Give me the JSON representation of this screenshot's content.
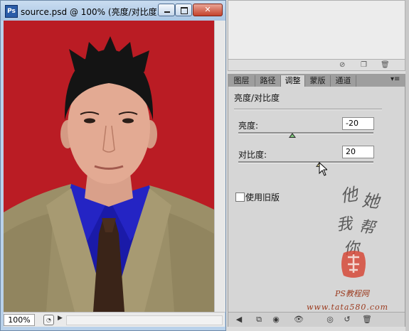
{
  "window": {
    "title": "source.psd @ 100% (亮度/对比度...",
    "app_icon": "Ps",
    "buttons": {
      "minimize": "minimize-icon",
      "maximize": "maximize-icon",
      "close": "✕"
    },
    "zoom": "100%"
  },
  "panel": {
    "tabs": [
      {
        "label": "图层",
        "active": false
      },
      {
        "label": "路径",
        "active": false
      },
      {
        "label": "调整",
        "active": true
      },
      {
        "label": "蒙版",
        "active": false
      },
      {
        "label": "通道",
        "active": false
      }
    ],
    "title": "亮度/对比度",
    "brightness": {
      "label": "亮度:",
      "value": "-20",
      "slider": -20
    },
    "contrast": {
      "label": "对比度:",
      "value": "20",
      "slider": 20
    },
    "legacy": {
      "label": "使用旧版",
      "checked": false
    },
    "watermark": {
      "chars": [
        "他",
        "她",
        "我",
        "帮",
        "你"
      ],
      "site_cn": "PS教程网",
      "site_url": "www.tata580.com"
    }
  },
  "colors": {
    "photo_bg": "#c11e26",
    "panel_bg": "#d6d6d6",
    "accent": "#2a5ca8"
  }
}
